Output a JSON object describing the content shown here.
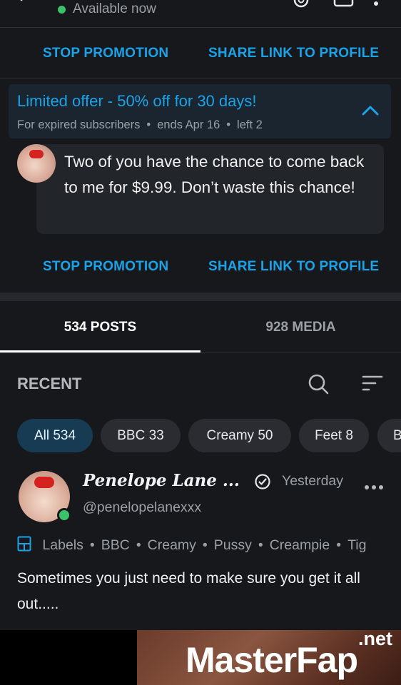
{
  "header": {
    "status": "Available now",
    "status_color": "#3cc26a"
  },
  "promo_actions_top": {
    "stop_label": "STOP PROMOTION",
    "share_label": "SHARE LINK TO PROFILE"
  },
  "offer": {
    "title": "Limited offer - 50% off for 30 days!",
    "audience": "For expired subscribers",
    "ends": "ends Apr 16",
    "left": "left 2",
    "message": "Two of you have the chance to come back to me for $9.99. Don’t waste this chance!"
  },
  "promo_actions_bottom": {
    "stop_label": "STOP PROMOTION",
    "share_label": "SHARE LINK TO PROFILE"
  },
  "tabs": [
    {
      "label": "534 POSTS",
      "active": true
    },
    {
      "label": "928 MEDIA",
      "active": false
    }
  ],
  "section": {
    "title": "RECENT"
  },
  "filters": [
    {
      "label": "All 534",
      "active": true
    },
    {
      "label": "BBC 33"
    },
    {
      "label": "Creamy 50"
    },
    {
      "label": "Feet 8"
    },
    {
      "label": "B"
    }
  ],
  "post": {
    "author": "Penelope Lane ...",
    "handle": "@penelopelanexxx",
    "time": "Yesterday",
    "labels_title": "Labels",
    "labels": [
      "BBC",
      "Creamy",
      "Pussy",
      "Creampie",
      "Tig"
    ],
    "text": "Sometimes you just need to make sure you get it all out....."
  },
  "watermark": {
    "brand": "MasterFap",
    "suffix": ".net"
  },
  "colors": {
    "accent": "#1aa3e8",
    "background": "#16181c",
    "chip": "#2a2c31",
    "chip_active": "#163b52"
  }
}
